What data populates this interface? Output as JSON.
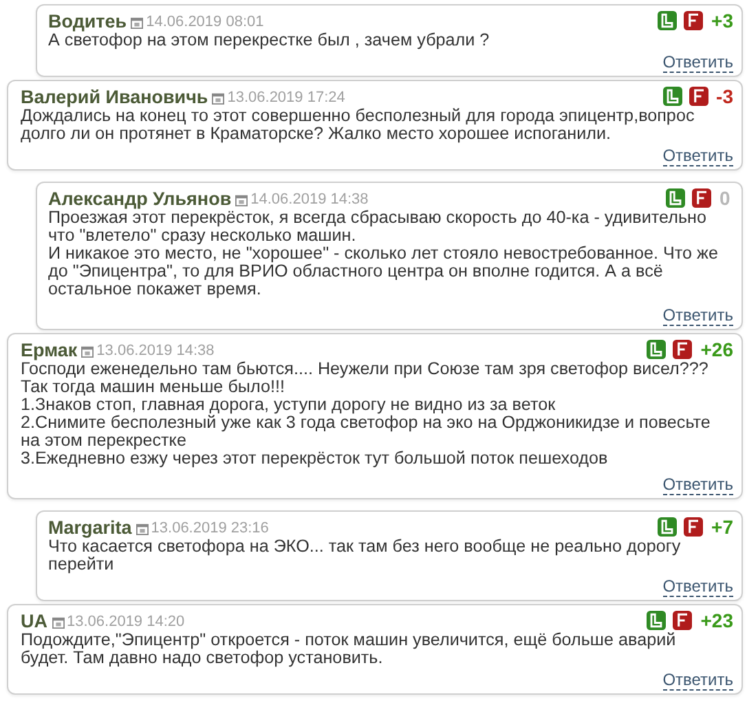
{
  "comments": [
    {
      "reply": true,
      "author": "Водитеь",
      "date": "14.06.2019 08:01",
      "score": "+3",
      "color": "#3a9a1a",
      "text": [
        "А светофор на этом перекрестке был , зачем убрали ?"
      ],
      "reply_link": "Ответить"
    },
    {
      "reply": false,
      "author": "Валерий Ивановичь",
      "date": "13.06.2019 17:24",
      "score": "-3",
      "color": "#c0281e",
      "text": [
        "Дождались на конец то этот совершенно бесполезный для города эпицентр,вопрос долго ли он протянет в Краматорске? Жалко место хорошее испоганили."
      ],
      "reply_link": "Ответить"
    },
    {
      "reply": true,
      "author": "Александр Ульянов",
      "date": "14.06.2019 14:38",
      "score": "0",
      "color": "#b8b8b8",
      "text": [
        "Проезжая этот перекрёсток, я всегда сбрасываю скорость до 40-ка - удивительно что \"влетело\" сразу несколько машин.",
        "И никакое это место, не \"хорошее\" - сколько лет стояло невостребованное. Что же до \"Эпицентра\", то для ВРИО областного центра он вполне годится. А а всё остальное покажет время."
      ],
      "reply_link": "Ответить"
    },
    {
      "reply": false,
      "author": "Ермак",
      "date": "13.06.2019 14:38",
      "score": "+26",
      "color": "#3a9a1a",
      "text": [
        "Господи еженедельно там бьются.... Неужели при Союзе там зря светофор висел???",
        "Так тогда машин меньше было!!!",
        "1.Знаков стоп, главная дорога, уступи дорогу не видно из за веток",
        "2.Снимите бесполезный уже как 3 года светофор на эко на Орджоникидзе и повесьте на этом перекрестке",
        "3.Ежедневно езжу через этот перекрёсток тут большой поток пешеходов"
      ],
      "reply_link": "Ответить"
    },
    {
      "reply": true,
      "author": "Margarita",
      "date": "13.06.2019 23:16",
      "score": "+7",
      "color": "#3a9a1a",
      "text": [
        "Что касается светофора на ЭКО... так там без него вообще не реально дорогу перейти"
      ],
      "reply_link": "Ответить"
    },
    {
      "reply": false,
      "author": "UA",
      "date": "13.06.2019 14:20",
      "score": "+23",
      "color": "#3a9a1a",
      "text": [
        "Подождите,\"Эпицентр\" откроется - поток машин увеличится, ещё больше аварий будет. Там давно надо светофор установить."
      ],
      "reply_link": "Ответить"
    }
  ]
}
